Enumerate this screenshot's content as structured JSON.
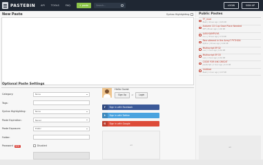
{
  "header": {
    "logo_text": "PASTEBIN",
    "nav": [
      "API",
      "TOOLS",
      "FAQ"
    ],
    "paste_button": "+ paste",
    "search_placeholder": "Search...",
    "login": "LOGIN",
    "signup": "SIGN UP"
  },
  "editor": {
    "title": "New Paste",
    "syntax_highlighting_label": "Syntax Highlighting",
    "content": ""
  },
  "options": {
    "title": "Optional Paste Settings",
    "fields": [
      {
        "label": "Category:",
        "value": "None"
      },
      {
        "label": "Tags:",
        "value": ""
      },
      {
        "label": "Syntax Highlighting:",
        "value": "None"
      },
      {
        "label": "Paste Expiration:",
        "value": "Never"
      },
      {
        "label": "Paste Exposure:",
        "value": "Public"
      },
      {
        "label": "Folder:",
        "value": ""
      }
    ],
    "password": {
      "label": "Password",
      "badge": "NEW",
      "value": "Disabled"
    }
  },
  "hello": {
    "title": "Hello Guest",
    "signup": "Sign Up",
    "or": "or",
    "login": "Login",
    "facebook": "Sign in with Facebook",
    "twitter": "Sign in with Twitter",
    "google": "Sign in with Google",
    "ad": "ad"
  },
  "public_pastes": {
    "title": "Public Pastes",
    "items": [
      {
        "title": "TF_mod",
        "meta": "Bash | 40 sec ago | 4.95 KB"
      },
      {
        "title": "Autumn 22 Cup Save Place Needed",
        "meta": "Diff | 26 sec ago | 1.46 KB"
      },
      {
        "title": "LIAN KAMPLIYA",
        "meta": "C++ | 33 sec ago | 0.74 KB"
      },
      {
        "title": "Recruitment in the Army? PYTHON",
        "meta": "Python | 49 sec ago | 0.94 KB"
      },
      {
        "title": "Multiscript EP.32",
        "meta": "Lua | 1 hour ago | 0.62 KB"
      },
      {
        "title": "Multiscript EP.33",
        "meta": "Lua | 1 hour ago | 0.62 KB"
      },
      {
        "title": "CODE FOR INK CREDIT",
        "meta": "JavaScript | 1 hour ago | 4.12 KB"
      },
      {
        "title": "Untitled",
        "meta": "Bash | 1 hour ago | 0.37 KB"
      }
    ],
    "ad": "ad"
  }
}
